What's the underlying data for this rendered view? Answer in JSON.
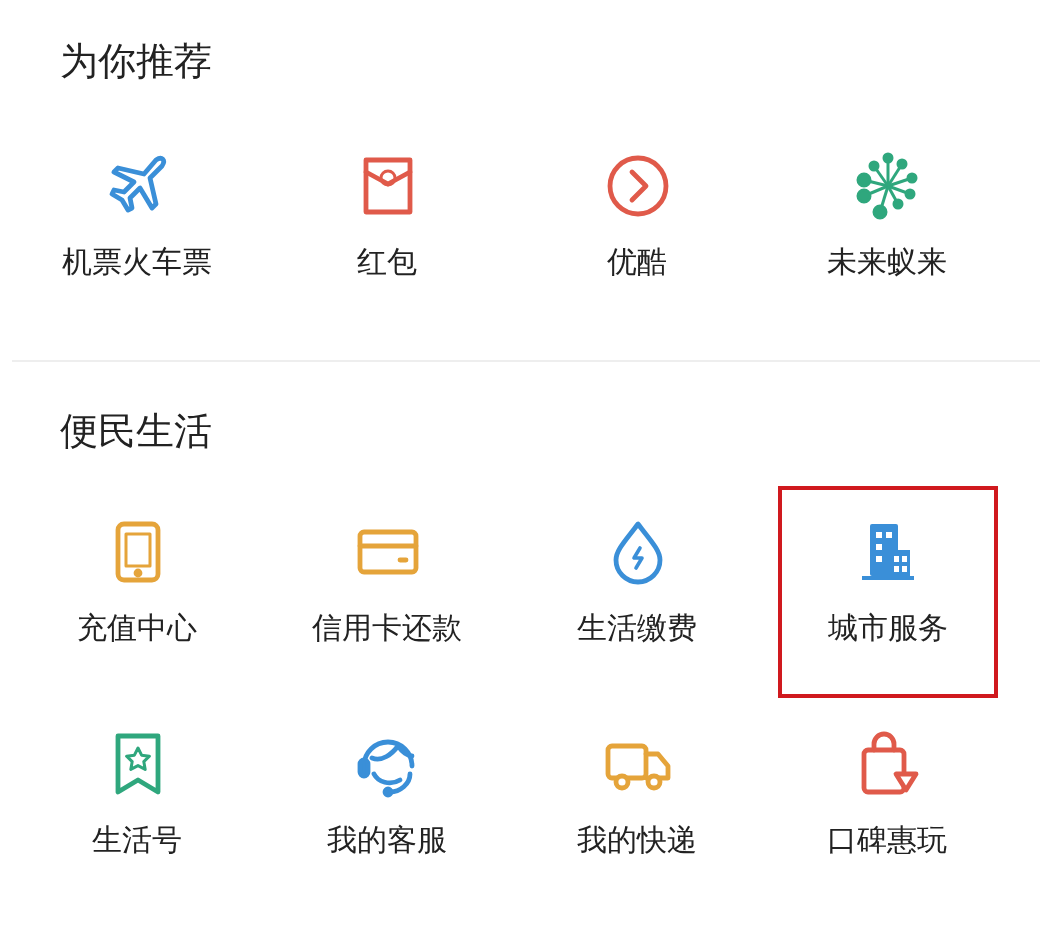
{
  "sections": [
    {
      "title": "为你推荐",
      "items": [
        {
          "label": "机票火车票",
          "kind": "plane",
          "color": "#3a8fd8",
          "highlighted": false
        },
        {
          "label": "红包",
          "kind": "envelope",
          "color": "#e05a4a",
          "highlighted": false
        },
        {
          "label": "优酷",
          "kind": "play",
          "color": "#e05a4a",
          "highlighted": false
        },
        {
          "label": "未来蚁来",
          "kind": "burst",
          "color": "#2fa77d",
          "highlighted": false
        }
      ]
    },
    {
      "title": "便民生活",
      "items": [
        {
          "label": "充值中心",
          "kind": "tablet",
          "color": "#e5a43a",
          "highlighted": false
        },
        {
          "label": "信用卡还款",
          "kind": "card",
          "color": "#e5a43a",
          "highlighted": false
        },
        {
          "label": "生活缴费",
          "kind": "drop",
          "color": "#3a8fd8",
          "highlighted": false
        },
        {
          "label": "城市服务",
          "kind": "building",
          "color": "#3a8fd8",
          "highlighted": true
        },
        {
          "label": "生活号",
          "kind": "bookmark",
          "color": "#2fa77d",
          "highlighted": false
        },
        {
          "label": "我的客服",
          "kind": "headset",
          "color": "#3a8fd8",
          "highlighted": false
        },
        {
          "label": "我的快递",
          "kind": "truck",
          "color": "#e5a43a",
          "highlighted": false
        },
        {
          "label": "口碑惠玩",
          "kind": "bag",
          "color": "#e05a4a",
          "highlighted": false
        }
      ]
    }
  ]
}
